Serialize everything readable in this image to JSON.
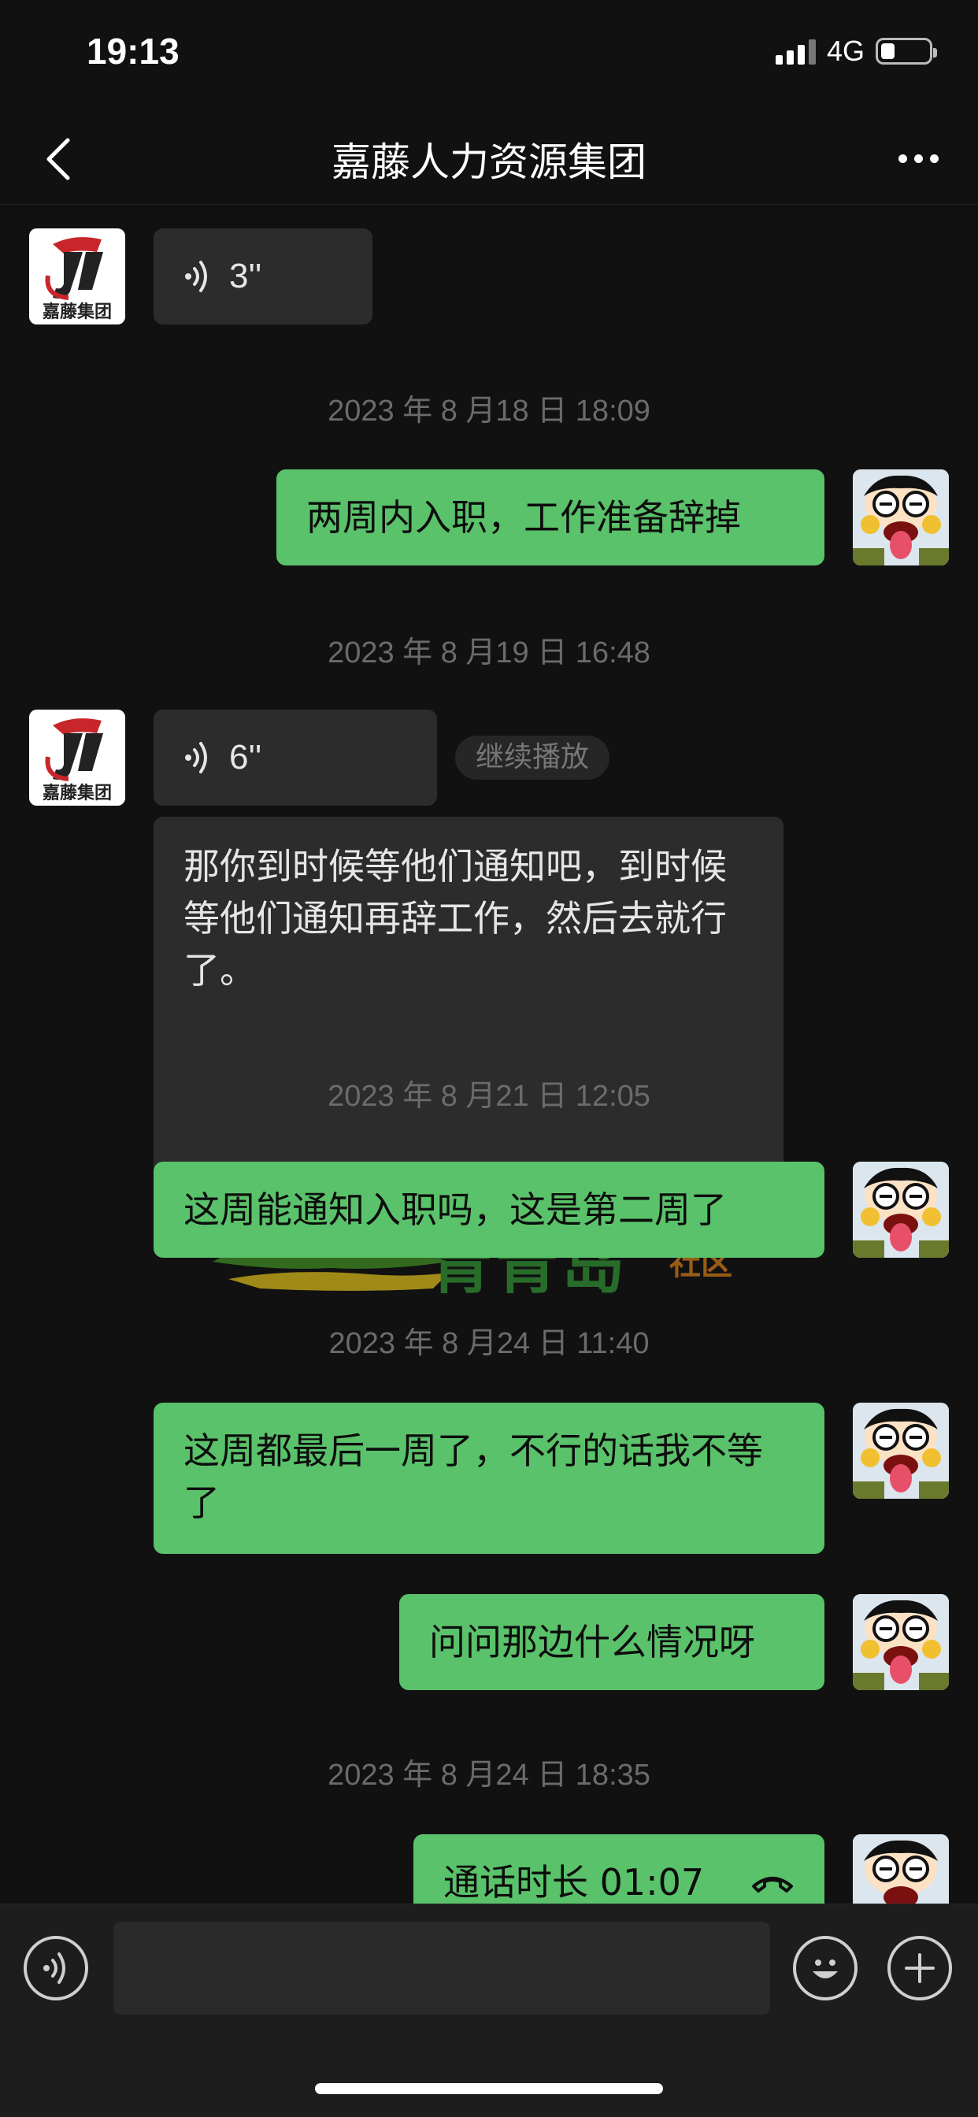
{
  "status": {
    "time": "19:13",
    "network": "4G",
    "battery_level": 0.3
  },
  "header": {
    "title": "嘉藤人力资源集团"
  },
  "contact": {
    "logo_text": "嘉藤集团"
  },
  "messages": {
    "voice1_duration": "3''",
    "ts1": "2023 年 8 月18 日 18:09",
    "out1": "两周内入职，工作准备辞掉",
    "ts2": "2023 年 8 月19 日 16:48",
    "voice2_duration": "6''",
    "continue_play": "继续播放",
    "in_text": "那你到时候等他们通知吧，到时候等他们通知再辞工作，然后去就行了。",
    "ts3": "2023 年 8 月21 日 12:05",
    "out2": "这周能通知入职吗，这是第二周了",
    "ts4": "2023 年 8 月24 日 11:40",
    "out3": "这周都最后一周了，不行的话我不等了",
    "out4": "问问那边什么情况呀",
    "ts5": "2023 年 8 月24 日 18:35",
    "call": "通话时长 01:07"
  },
  "watermark": {
    "brand": "青青岛",
    "suffix": "社区"
  },
  "input": {
    "placeholder": ""
  },
  "colors": {
    "bubble_out": "#5ac26a",
    "bubble_in": "#2c2c2c",
    "background": "#111111"
  },
  "icons": [
    "back-icon",
    "more-icon",
    "voice-wave-icon",
    "phone-icon",
    "voice-input-icon",
    "emoji-icon",
    "plus-icon"
  ]
}
